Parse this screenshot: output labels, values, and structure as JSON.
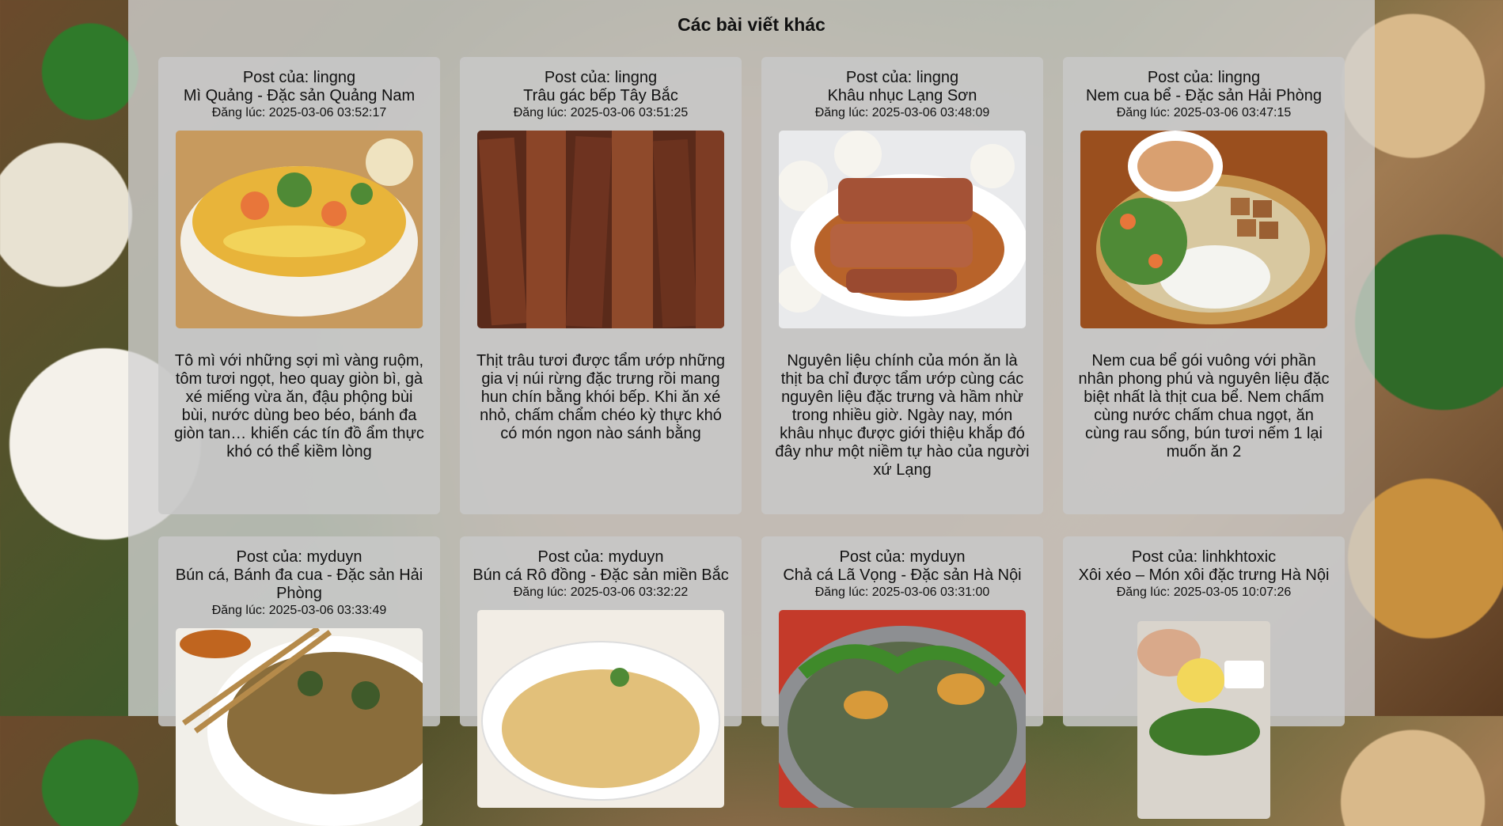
{
  "section_title": "Các bài viết khác",
  "posts": [
    {
      "author": "Post của: lingng",
      "title": "Mì Quảng - Đặc sản Quảng Nam",
      "date": "Đăng lúc: 2025-03-06 03:52:17",
      "image_alt": "mi-quang-photo",
      "description": "Tô mì với những sợi mì vàng ruộm, tôm tươi ngọt, heo quay giòn bì, gà xé miếng vừa ăn, đậu phộng bùi bùi, nước dùng beo béo, bánh đa giòn tan… khiến các tín đồ ẩm thực khó có thể kiềm lòng"
    },
    {
      "author": "Post của: lingng",
      "title": "Trâu gác bếp Tây Bắc",
      "date": "Đăng lúc: 2025-03-06 03:51:25",
      "image_alt": "trau-gac-bep-photo",
      "description": "Thịt trâu tươi được tẩm ướp những gia vị núi rừng đặc trưng rồi mang hun chín bằng khói bếp. Khi ăn xé nhỏ, chấm chẩm chéo kỳ thực khó có món ngon nào sánh bằng"
    },
    {
      "author": "Post của: lingng",
      "title": "Khâu nhục Lạng Sơn",
      "date": "Đăng lúc: 2025-03-06 03:48:09",
      "image_alt": "khau-nhuc-photo",
      "description": "Nguyên liệu chính của món ăn là thịt ba chỉ được tẩm ướp cùng các nguyên liệu đặc trưng và hầm nhừ trong nhiều giờ. Ngày nay, món khâu nhục được giới thiệu khắp đó đây như một niềm tự hào của người xứ Lạng"
    },
    {
      "author": "Post của: lingng",
      "title": "Nem cua bể - Đặc sản Hải Phòng",
      "date": "Đăng lúc: 2025-03-06 03:47:15",
      "image_alt": "nem-cua-be-photo",
      "description": "Nem cua bể gói vuông với phần nhân phong phú và nguyên liệu đặc biệt nhất là thịt cua bể. Nem chấm cùng nước chấm chua ngọt, ăn cùng rau sống, bún tươi nếm 1 lại muốn ăn 2"
    },
    {
      "author": "Post của: myduyn",
      "title": "Bún cá, Bánh đa cua - Đặc sản Hải Phòng",
      "date": "Đăng lúc: 2025-03-06 03:33:49",
      "image_alt": "bun-ca-photo",
      "description": ""
    },
    {
      "author": "Post của: myduyn",
      "title": "Bún cá Rô đồng - Đặc sản miền Bắc",
      "date": "Đăng lúc: 2025-03-06 03:32:22",
      "image_alt": "bun-ca-ro-dong-photo",
      "description": ""
    },
    {
      "author": "Post của: myduyn",
      "title": "Chả cá Lã Vọng - Đặc sản Hà Nội",
      "date": "Đăng lúc: 2025-03-06 03:31:00",
      "image_alt": "cha-ca-photo",
      "description": ""
    },
    {
      "author": "Post của: linhkhtoxic",
      "title": "Xôi xéo – Món xôi đặc trưng Hà Nội",
      "date": "Đăng lúc: 2025-03-05 10:07:26",
      "image_alt": "xoi-xeo-photo",
      "description": ""
    }
  ]
}
